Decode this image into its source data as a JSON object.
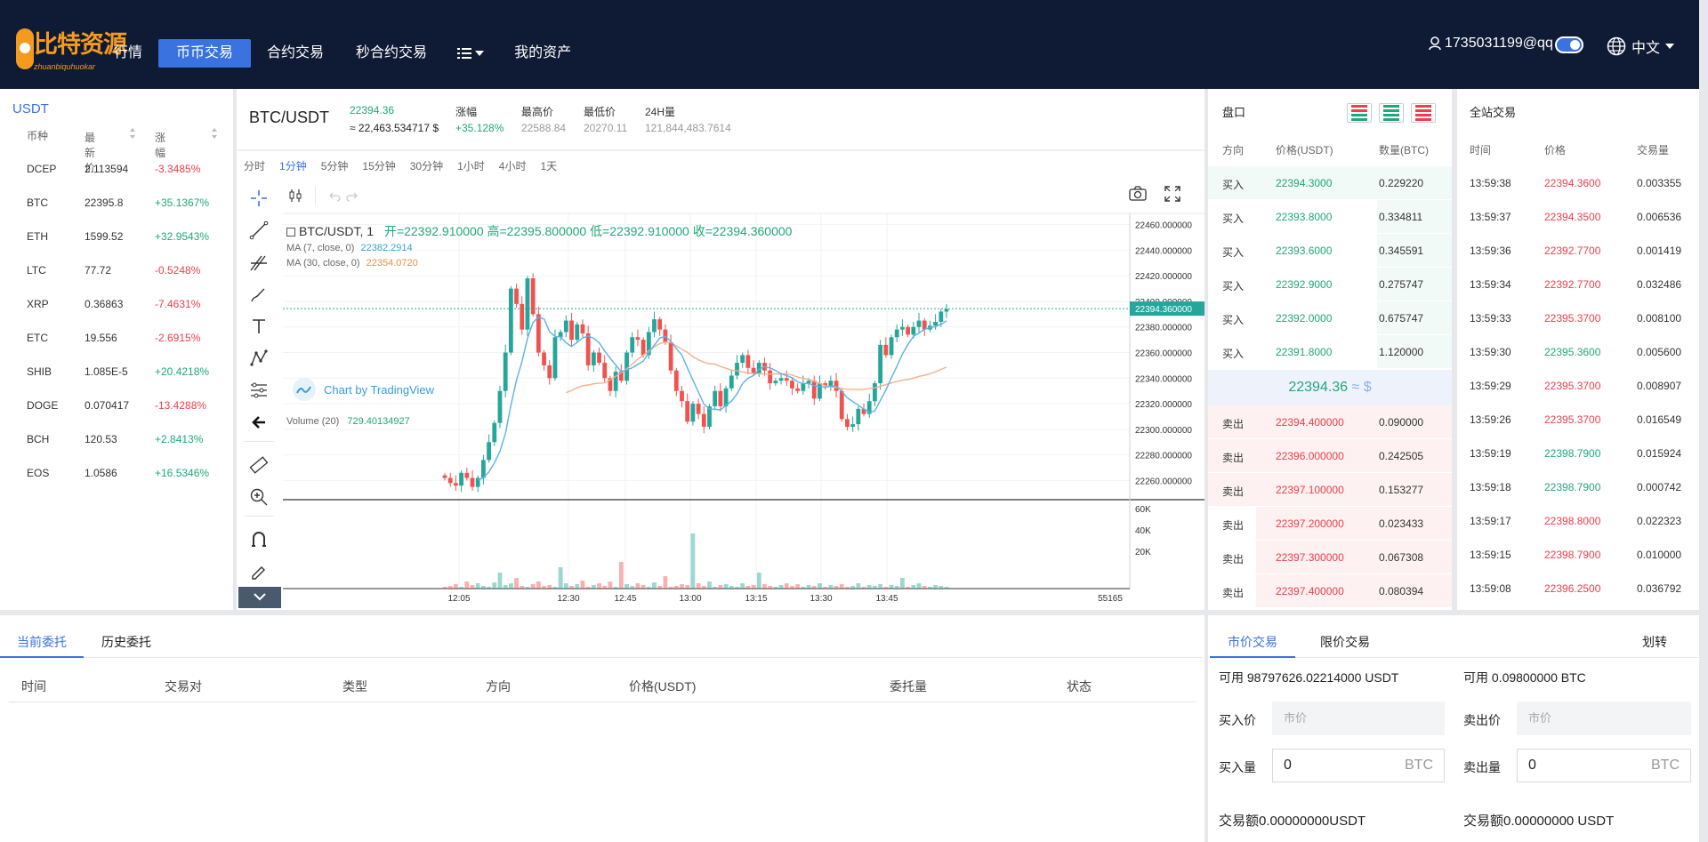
{
  "header": {
    "logo_text": "比特资源",
    "logo_sub": "zhuanbiquhuokar",
    "nav": [
      "行情",
      "币币交易",
      "合约交易",
      "秒合约交易",
      "我的资产"
    ],
    "user": "1735031199@qq",
    "language": "中文"
  },
  "market": {
    "title": "USDT",
    "headers": [
      "币种",
      "最新价",
      "涨幅"
    ],
    "rows": [
      {
        "coin": "DCEP",
        "price": "2.113594",
        "change": "-3.3485%",
        "dir": "down"
      },
      {
        "coin": "BTC",
        "price": "22395.8",
        "change": "+35.1367%",
        "dir": "up"
      },
      {
        "coin": "ETH",
        "price": "1599.52",
        "change": "+32.9543%",
        "dir": "up"
      },
      {
        "coin": "LTC",
        "price": "77.72",
        "change": "-0.5248%",
        "dir": "down"
      },
      {
        "coin": "XRP",
        "price": "0.36863",
        "change": "-7.4631%",
        "dir": "down"
      },
      {
        "coin": "ETC",
        "price": "19.556",
        "change": "-2.6915%",
        "dir": "down"
      },
      {
        "coin": "SHIB",
        "price": "1.085E-5",
        "change": "+20.4218%",
        "dir": "up"
      },
      {
        "coin": "DOGE",
        "price": "0.070417",
        "change": "-13.4288%",
        "dir": "down"
      },
      {
        "coin": "BCH",
        "price": "120.53",
        "change": "+2.8413%",
        "dir": "up"
      },
      {
        "coin": "EOS",
        "price": "1.0586",
        "change": "+16.5346%",
        "dir": "up"
      }
    ]
  },
  "ticker": {
    "pair": "BTC/USDT",
    "last": "22394.36",
    "approx": "≈ 22,463.534717 $",
    "change_label": "涨幅",
    "change": "+35.128%",
    "high_label": "最高价",
    "high": "22588.84",
    "low_label": "最低价",
    "low": "20270.11",
    "vol_label": "24H量",
    "vol": "121,844,483.7614"
  },
  "chart": {
    "intervals": [
      "分时",
      "1分钟",
      "5分钟",
      "15分钟",
      "30分钟",
      "1小时",
      "4小时",
      "1天"
    ],
    "active_interval": "1分钟",
    "legend_symbol": "BTC/USDT, 1",
    "ohlc": "开=22392.910000  高=22395.800000  低=22392.910000  收=22394.360000",
    "ma7_label": "MA (7, close, 0)",
    "ma7_value": "22382.2914",
    "ma30_label": "MA (30, close, 0)",
    "ma30_value": "22354.0720",
    "watermark": "Chart by TradingView",
    "volume_label": "Volume (20)",
    "volume_value": "729.40134927",
    "last_price_tag": "22394.360000",
    "clock_label": "55165"
  },
  "chart_data": {
    "type": "candlestick",
    "yaxis_ticks": [
      "22460.000000",
      "22440.000000",
      "22420.000000",
      "22400.000000",
      "22380.000000",
      "22360.000000",
      "22340.000000",
      "22320.000000",
      "22300.000000",
      "22280.000000",
      "22260.000000"
    ],
    "ylim": [
      22245,
      22466
    ],
    "xaxis_ticks": [
      "12:05",
      "12:30",
      "12:45",
      "13:00",
      "13:15",
      "13:30",
      "13:45"
    ],
    "volume_ticks": [
      "60K",
      "40K",
      "20K"
    ],
    "last_price": 22394.36,
    "ma7_last": 22382.2914,
    "ma30_last": 22354.072,
    "series_ma7_color": "#5bb1e6",
    "series_ma30_color": "#f3b08a",
    "up_color": "#26a69a",
    "down_color": "#ef5350"
  },
  "orderbook": {
    "title": "盘口",
    "headers": [
      "方向",
      "价格(USDT)",
      "数量(BTC)"
    ],
    "bids": [
      {
        "side": "买入",
        "price": "22394.3000",
        "qty": "0.229220"
      },
      {
        "side": "买入",
        "price": "22393.8000",
        "qty": "0.334811"
      },
      {
        "side": "买入",
        "price": "22393.6000",
        "qty": "0.345591"
      },
      {
        "side": "买入",
        "price": "22392.9000",
        "qty": "0.275747"
      },
      {
        "side": "买入",
        "price": "22392.0000",
        "qty": "0.675747"
      },
      {
        "side": "买入",
        "price": "22391.8000",
        "qty": "1.120000"
      }
    ],
    "mid": "22394.36",
    "mid_approx": "≈ $",
    "asks": [
      {
        "side": "卖出",
        "price": "22394.400000",
        "qty": "0.090000"
      },
      {
        "side": "卖出",
        "price": "22396.000000",
        "qty": "0.242505"
      },
      {
        "side": "卖出",
        "price": "22397.100000",
        "qty": "0.153277"
      },
      {
        "side": "卖出",
        "price": "22397.200000",
        "qty": "0.023433"
      },
      {
        "side": "卖出",
        "price": "22397.300000",
        "qty": "0.067308"
      },
      {
        "side": "卖出",
        "price": "22397.400000",
        "qty": "0.080394"
      }
    ]
  },
  "trades": {
    "title": "全站交易",
    "headers": [
      "时间",
      "价格",
      "交易量"
    ],
    "rows": [
      {
        "time": "13:59:38",
        "price": "22394.3600",
        "qty": "0.003355",
        "dir": "down"
      },
      {
        "time": "13:59:37",
        "price": "22394.3500",
        "qty": "0.006536",
        "dir": "down"
      },
      {
        "time": "13:59:36",
        "price": "22392.7700",
        "qty": "0.001419",
        "dir": "down"
      },
      {
        "time": "13:59:34",
        "price": "22392.7700",
        "qty": "0.032486",
        "dir": "down"
      },
      {
        "time": "13:59:33",
        "price": "22395.3700",
        "qty": "0.008100",
        "dir": "down"
      },
      {
        "time": "13:59:30",
        "price": "22395.3600",
        "qty": "0.005600",
        "dir": "up"
      },
      {
        "time": "13:59:29",
        "price": "22395.3700",
        "qty": "0.008907",
        "dir": "down"
      },
      {
        "time": "13:59:26",
        "price": "22395.3700",
        "qty": "0.016549",
        "dir": "down"
      },
      {
        "time": "13:59:19",
        "price": "22398.7900",
        "qty": "0.015924",
        "dir": "up"
      },
      {
        "time": "13:59:18",
        "price": "22398.7900",
        "qty": "0.000742",
        "dir": "up"
      },
      {
        "time": "13:59:17",
        "price": "22398.8000",
        "qty": "0.022323",
        "dir": "down"
      },
      {
        "time": "13:59:15",
        "price": "22398.7900",
        "qty": "0.010000",
        "dir": "down"
      },
      {
        "time": "13:59:08",
        "price": "22396.2500",
        "qty": "0.036792",
        "dir": "down"
      }
    ]
  },
  "orders": {
    "tabs": [
      "当前委托",
      "历史委托"
    ],
    "headers": [
      "时间",
      "交易对",
      "类型",
      "方向",
      "价格(USDT)",
      "委托量",
      "状态"
    ]
  },
  "tradeform": {
    "tabs": [
      "市价交易",
      "限价交易"
    ],
    "transfer": "划转",
    "buy_available": "可用 98797626.02214000 USDT",
    "sell_available": "可用 0.09800000 BTC",
    "buy_price_label": "买入价",
    "sell_price_label": "卖出价",
    "price_placeholder": "市价",
    "buy_qty_label": "买入量",
    "sell_qty_label": "卖出量",
    "qty_value": "0",
    "qty_unit": "BTC",
    "buy_total": "交易额0.00000000USDT",
    "sell_total": "交易额0.00000000 USDT"
  },
  "colors": {
    "accent": "#3a72e0",
    "up": "#20a779",
    "down": "#ef3e4a",
    "topbar": "#0f1a34"
  }
}
